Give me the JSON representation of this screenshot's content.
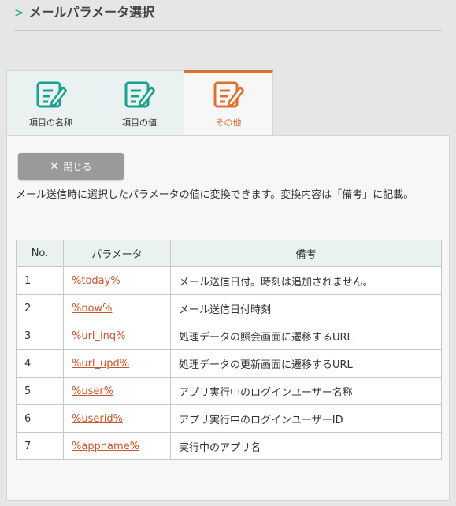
{
  "header": {
    "title": "メールパラメータ選択"
  },
  "tabs": [
    {
      "label": "項目の名称"
    },
    {
      "label": "項目の値"
    },
    {
      "label": "その他"
    }
  ],
  "colors": {
    "accent": "#e07030",
    "teal": "#1aa08f",
    "link": "#c9572b"
  },
  "close_button": {
    "label": "閉じる"
  },
  "description": "メール送信時に選択したパラメータの値に変換できます。変換内容は「備考」に記載。",
  "table": {
    "headers": {
      "no": "No.",
      "param": "パラメータ",
      "note": "備考"
    },
    "rows": [
      {
        "no": "1",
        "param": "%today%",
        "note": "メール送信日付。時刻は追加されません。"
      },
      {
        "no": "2",
        "param": "%now%",
        "note": "メール送信日付時刻"
      },
      {
        "no": "3",
        "param": "%url_inq%",
        "note": "処理データの照会画面に遷移するURL"
      },
      {
        "no": "4",
        "param": "%url_upd%",
        "note": "処理データの更新画面に遷移するURL"
      },
      {
        "no": "5",
        "param": "%user%",
        "note": "アプリ実行中のログインユーザー名称"
      },
      {
        "no": "6",
        "param": "%userid%",
        "note": "アプリ実行中のログインユーザーID"
      },
      {
        "no": "7",
        "param": "%appname%",
        "note": "実行中のアプリ名"
      }
    ]
  }
}
